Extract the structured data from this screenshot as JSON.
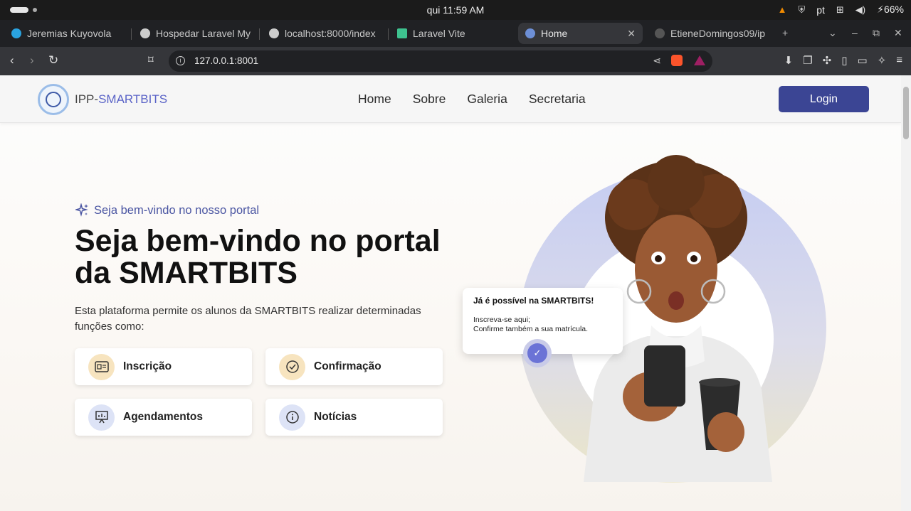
{
  "os": {
    "clock": "qui 11:59 AM",
    "language": "pt",
    "battery": "66%"
  },
  "tabs": [
    {
      "label": "Jeremias Kuyovola",
      "color": "#2aa3e0"
    },
    {
      "label": "Hospedar Laravel My",
      "color": "#cccccc"
    },
    {
      "label": "localhost:8000/index",
      "color": "#cccccc"
    },
    {
      "label": "Laravel Vite",
      "color": "#3ec28f"
    },
    {
      "label": "Home",
      "color": "#6d8fd6",
      "active": true
    },
    {
      "label": "EtieneDomingos09/ip",
      "color": "#555555"
    }
  ],
  "browser": {
    "url": "127.0.0.1:8001"
  },
  "site": {
    "brand_prefix": "IPP-",
    "brand_accent": "SMARTBITS",
    "nav": [
      "Home",
      "Sobre",
      "Galeria",
      "Secretaria"
    ],
    "login_label": "Login",
    "accent_color": "#3b4594"
  },
  "hero": {
    "eyebrow": "Seja bem-vindo no nosso portal",
    "title": "Seja bem-vindo no portal da SMARTBITS",
    "description": "Esta plataforma permite os alunos da SMARTBITS realizar determinadas funções como:",
    "cards": [
      {
        "label": "Inscrição",
        "icon": "id-card-icon"
      },
      {
        "label": "Confirmação",
        "icon": "check-circle-icon"
      },
      {
        "label": "Agendamentos",
        "icon": "presentation-icon"
      },
      {
        "label": "Notícias",
        "icon": "info-icon"
      }
    ]
  },
  "popup": {
    "title": "Já é possível na SMARTBITS!",
    "line1": "Inscreva-se aqui;",
    "line2": "Confirme também a sua matrícula."
  }
}
